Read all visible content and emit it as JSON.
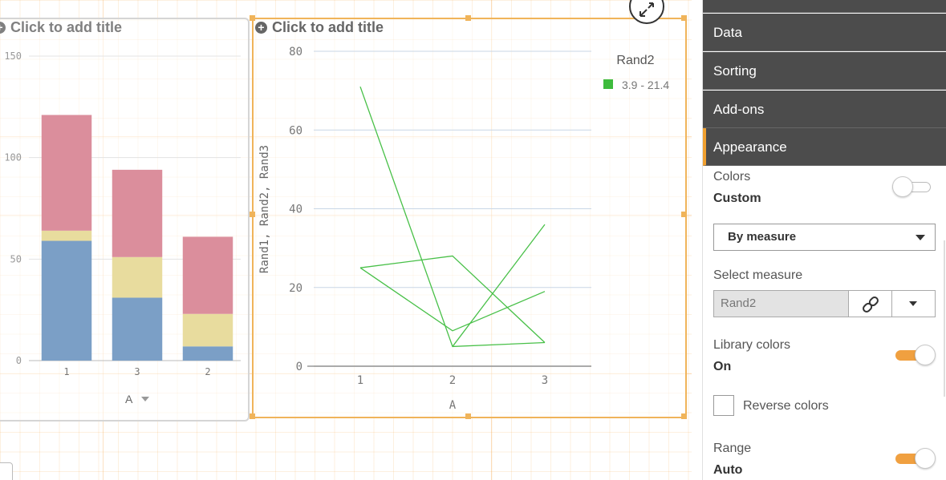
{
  "left_chart": {
    "title": "Click to add title",
    "dimension_label": "A",
    "chart_data": {
      "type": "bar",
      "stacked": true,
      "categories": [
        "1",
        "3",
        "2"
      ],
      "series": [
        {
          "values": [
            59,
            31,
            7
          ],
          "color": "#7b9fc6"
        },
        {
          "values": [
            5,
            20,
            16
          ],
          "color": "#e8dc9e"
        },
        {
          "values": [
            57,
            43,
            38
          ],
          "color": "#db8e9c"
        }
      ],
      "yticks": [
        0,
        50,
        100,
        150
      ],
      "ylim": [
        0,
        150
      ],
      "grid": true
    }
  },
  "right_chart": {
    "title": "Click to add title",
    "chart_data": {
      "type": "line",
      "x": [
        "1",
        "2",
        "3"
      ],
      "series": [
        {
          "values": [
            71,
            5,
            6
          ],
          "color": "#48c048"
        },
        {
          "values": [
            25,
            28,
            6
          ],
          "color": "#48c048"
        },
        {
          "values": [
            25,
            9,
            19
          ],
          "color": "#48c048"
        },
        {
          "values": [
            null,
            5,
            36
          ],
          "color": "#48c048"
        }
      ],
      "ylabel": "Rand1, Rand2, Rand3",
      "xlabel": "A",
      "yticks": [
        0,
        20,
        40,
        60,
        80
      ],
      "ylim": [
        0,
        80
      ],
      "grid": true,
      "legend": {
        "title": "Rand2",
        "entry": "3.9 - 21.4",
        "color": "#3dbb3d",
        "placement": "top-right"
      }
    }
  },
  "panel": {
    "sections": {
      "data": "Data",
      "sorting": "Sorting",
      "addons": "Add-ons",
      "appearance": "Appearance"
    },
    "colors_label": "Colors",
    "colors_value": "Custom",
    "colors_toggle_on": false,
    "color_mode": "By measure",
    "select_measure_label": "Select measure",
    "measure_value": "Rand2",
    "library_colors_label": "Library colors",
    "library_colors_value": "On",
    "library_toggle_on": true,
    "reverse_colors_label": "Reverse colors",
    "reverse_checked": false,
    "range_label": "Range",
    "range_value": "Auto",
    "range_toggle_on": true,
    "accent_color": "#f0a030"
  }
}
